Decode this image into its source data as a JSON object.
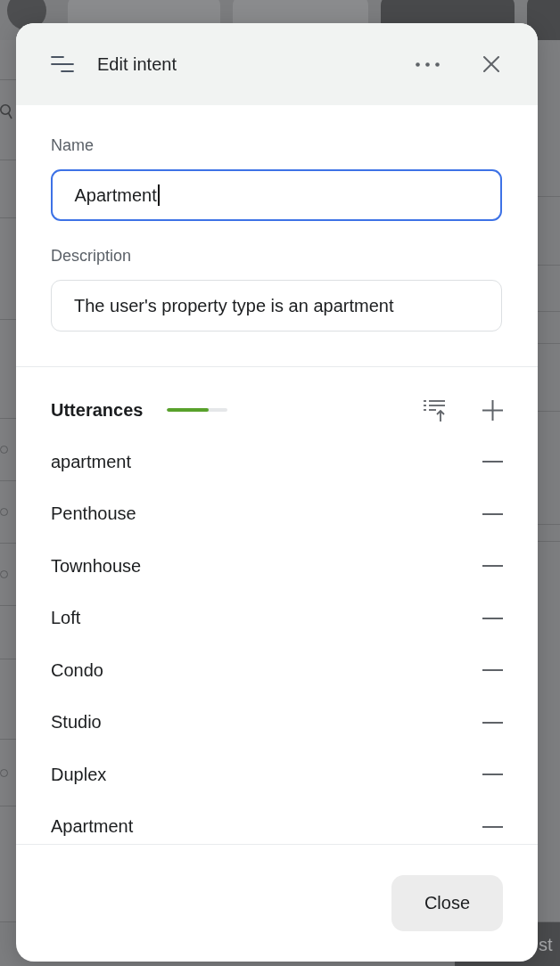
{
  "backdrop": {
    "bottom_button_text": "st"
  },
  "dialog": {
    "title": "Edit intent"
  },
  "fields": [
    {
      "label": "Name",
      "value": "Apartment",
      "focused": true
    },
    {
      "label": "Description",
      "value": "The user's property type is an apartment",
      "focused": false
    }
  ],
  "utterances": {
    "title": "Utterances",
    "level": 0.68,
    "items": [
      "apartment",
      "Penthouse",
      "Townhouse",
      "Loft",
      "Condo",
      "Studio",
      "Duplex",
      "Apartment"
    ]
  },
  "footer": {
    "buttons": [
      "Close"
    ]
  }
}
